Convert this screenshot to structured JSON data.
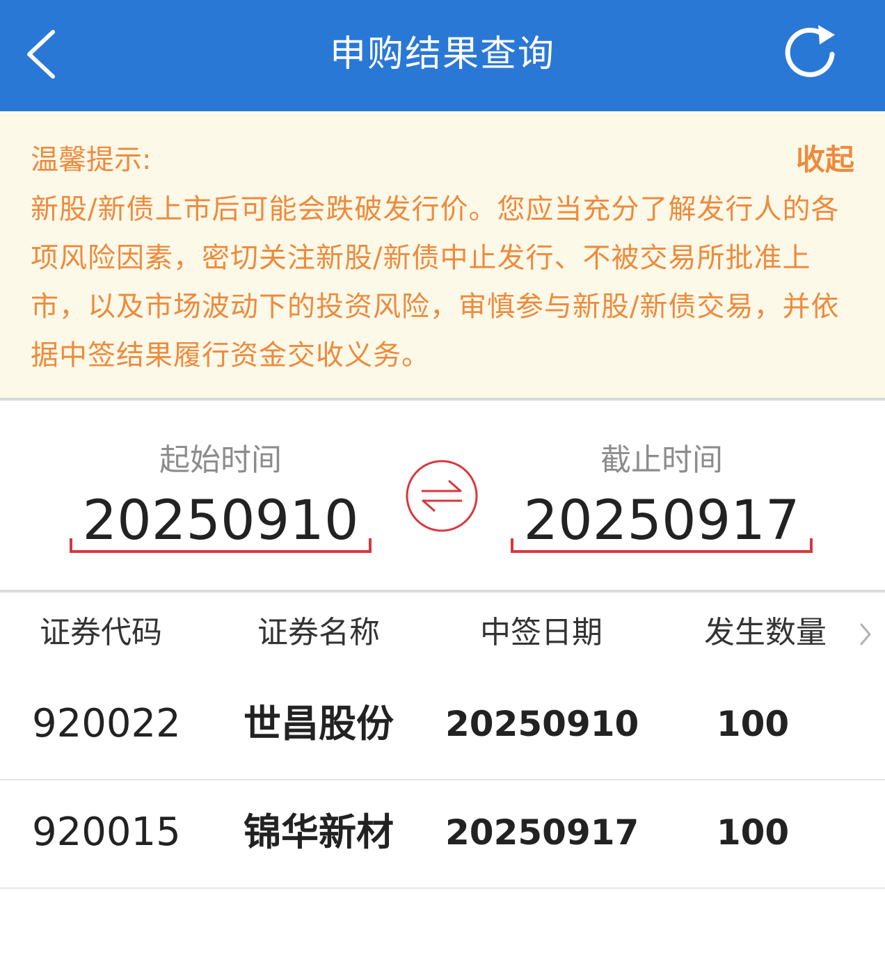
{
  "header": {
    "title": "申购结果查询",
    "back_icon": "chevron-left-icon",
    "refresh_icon": "refresh-icon",
    "bg_color": "#2a78d6"
  },
  "notice": {
    "title": "温馨提示:",
    "collapse_label": "收起",
    "body": "新股/新债上市后可能会跌破发行价。您应当充分了解发行人的各项风险因素，密切关注新股/新债中止发行、不被交易所批准上市，以及市场波动下的投资风险，审慎参与新股/新债交易，并依据中签结果履行资金交收义务。",
    "text_color": "#ee8a3c",
    "bg_color": "#fdf9e9"
  },
  "dates": {
    "start_label": "起始时间",
    "start_value": "20250910",
    "end_label": "截止时间",
    "end_value": "20250917",
    "swap_icon": "swap-arrows-icon",
    "accent_color": "#d9363e"
  },
  "table": {
    "columns": [
      "证券代码",
      "证券名称",
      "中签日期",
      "发生数量"
    ],
    "more_icon": "chevron-right-icon",
    "rows": [
      {
        "code": "920022",
        "name": "世昌股份",
        "date": "20250910",
        "qty": "100"
      },
      {
        "code": "920015",
        "name": "锦华新材",
        "date": "20250917",
        "qty": "100"
      }
    ]
  }
}
